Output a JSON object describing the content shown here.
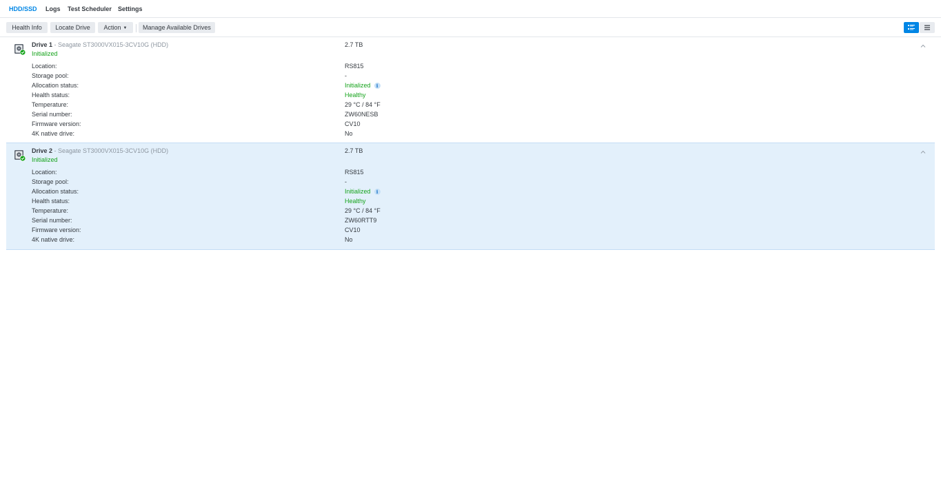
{
  "tabs": [
    "HDD/SSD",
    "Logs",
    "Test Scheduler",
    "Settings"
  ],
  "toolbar": {
    "health_info": "Health Info",
    "locate_drive": "Locate Drive",
    "action": "Action",
    "manage_drives": "Manage Available Drives"
  },
  "colors": {
    "accent": "#0086e5",
    "success": "#16a31c",
    "selected_row": "#e3f0fb"
  },
  "drives": [
    {
      "name": "Drive 1",
      "model": " - Seagate ST3000VX015-3CV10G (HDD)",
      "status": "Initialized",
      "capacity": "2.7 TB",
      "fields": [
        {
          "label": "Location:",
          "value": "RS815"
        },
        {
          "label": "Storage pool:",
          "value": "-"
        },
        {
          "label": "Allocation status:",
          "value": "Initialized"
        },
        {
          "label": "Health status:",
          "value": "Healthy"
        },
        {
          "label": "Temperature:",
          "value": "29 °C / 84 °F"
        },
        {
          "label": "Serial number:",
          "value": "ZW60NESB"
        },
        {
          "label": "Firmware version:",
          "value": "CV10"
        },
        {
          "label": "4K native drive:",
          "value": "No"
        }
      ]
    },
    {
      "name": "Drive 2",
      "model": " - Seagate ST3000VX015-3CV10G (HDD)",
      "status": "Initialized",
      "capacity": "2.7 TB",
      "fields": [
        {
          "label": "Location:",
          "value": "RS815"
        },
        {
          "label": "Storage pool:",
          "value": "-"
        },
        {
          "label": "Allocation status:",
          "value": "Initialized"
        },
        {
          "label": "Health status:",
          "value": "Healthy"
        },
        {
          "label": "Temperature:",
          "value": "29 °C / 84 °F"
        },
        {
          "label": "Serial number:",
          "value": "ZW60RTT9"
        },
        {
          "label": "Firmware version:",
          "value": "CV10"
        },
        {
          "label": "4K native drive:",
          "value": "No"
        }
      ]
    }
  ]
}
